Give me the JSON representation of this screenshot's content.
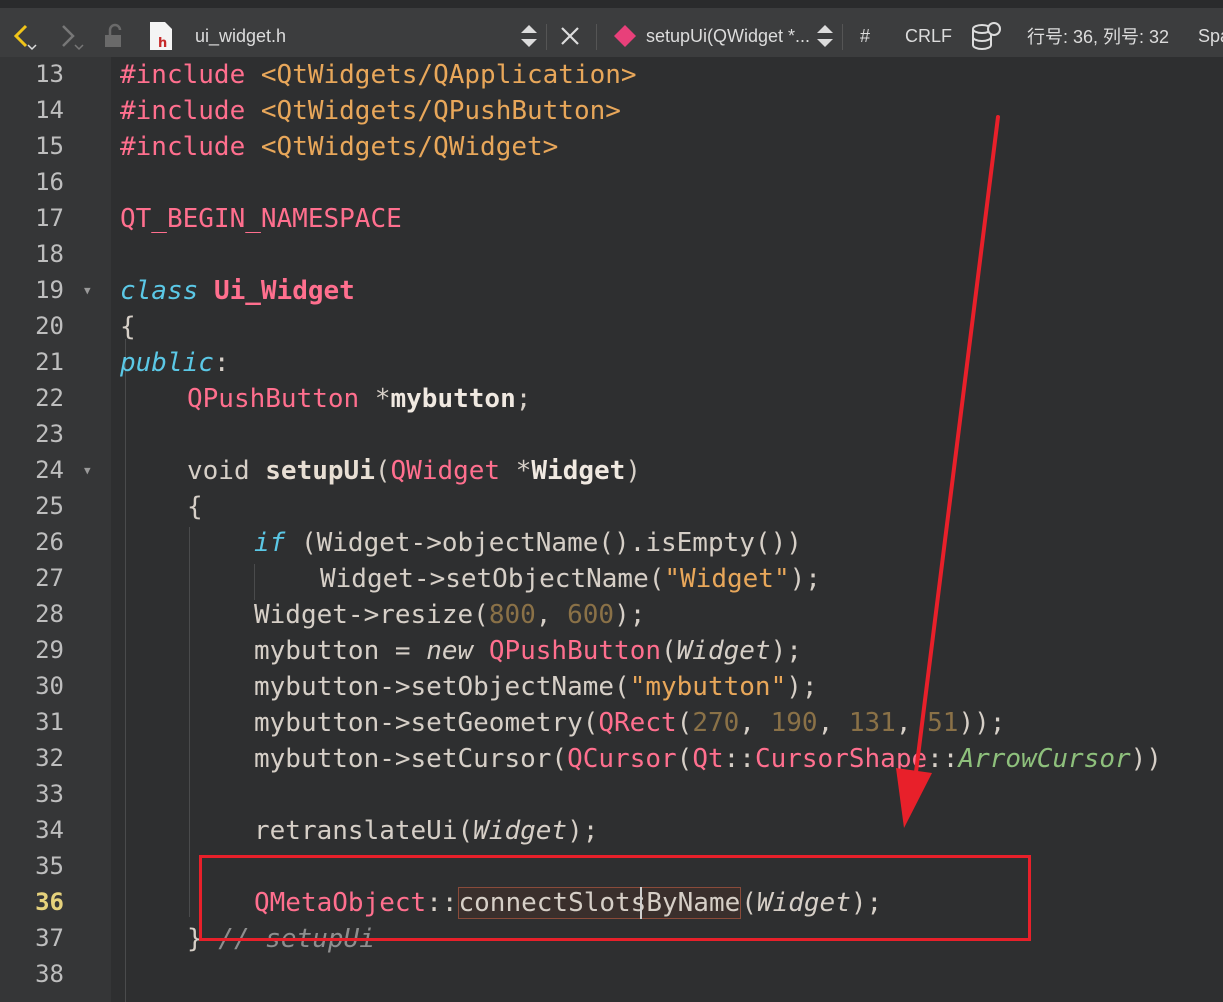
{
  "toolbar": {
    "filename": "ui_widget.h",
    "function_selector": "setupUi(QWidget *...",
    "hash_symbol": "#",
    "line_ending": "CRLF",
    "cursor_position": "行号: 36, 列号: 32",
    "indent_mode": "Spa"
  },
  "line_numbers": [
    "13",
    "14",
    "15",
    "16",
    "17",
    "18",
    "19",
    "20",
    "21",
    "22",
    "23",
    "24",
    "25",
    "26",
    "27",
    "28",
    "29",
    "30",
    "31",
    "32",
    "33",
    "34",
    "35",
    "36",
    "37",
    "38"
  ],
  "current_line": "36",
  "code": {
    "l13_a": "#include",
    "l13_b": " <QtWidgets/QApplication>",
    "l14_a": "#include",
    "l14_b": " <QtWidgets/QPushButton>",
    "l15_a": "#include",
    "l15_b": " <QtWidgets/QWidget>",
    "l17": "QT_BEGIN_NAMESPACE",
    "l19_a": "class",
    "l19_b": "Ui_Widget",
    "l20": "{",
    "l21_a": "public",
    "l21_b": ":",
    "l22_a": "QPushButton",
    "l22_b": " *",
    "l22_c": "mybutton",
    "l22_d": ";",
    "l24_a": "void ",
    "l24_b": "setupUi",
    "l24_c": "(",
    "l24_d": "QWidget",
    "l24_e": " *",
    "l24_f": "Widget",
    "l24_g": ")",
    "l25": "{",
    "l26_a": "if",
    "l26_b": " (Widget->objectName().isEmpty())",
    "l27_a": "Widget->setObjectName(",
    "l27_b": "\"Widget\"",
    "l27_c": ");",
    "l28_a": "Widget->resize(",
    "l28_b": "800",
    "l28_c": ", ",
    "l28_d": "600",
    "l28_e": ");",
    "l29_a": "mybutton = ",
    "l29_b": "new",
    "l29_c": " ",
    "l29_d": "QPushButton",
    "l29_e": "(",
    "l29_f": "Widget",
    "l29_g": ");",
    "l30_a": "mybutton->setObjectName(",
    "l30_b": "\"mybutton\"",
    "l30_c": ");",
    "l31_a": "mybutton->setGeometry(",
    "l31_b": "QRect",
    "l31_c": "(",
    "l31_d": "270",
    "l31_e": ", ",
    "l31_f": "190",
    "l31_g": ", ",
    "l31_h": "131",
    "l31_i": ", ",
    "l31_j": "51",
    "l31_k": "));",
    "l32_a": "mybutton->setCursor(",
    "l32_b": "QCursor",
    "l32_c": "(",
    "l32_d": "Qt",
    "l32_e": "::",
    "l32_f": "CursorShape",
    "l32_g": "::",
    "l32_h": "ArrowCursor",
    "l32_i": "))",
    "l34_a": "retranslateUi(",
    "l34_b": "Widget",
    "l34_c": ");",
    "l36_a": "QMetaObject",
    "l36_b": "::",
    "l36_c": "connectSlotsByName",
    "l36_d": "(",
    "l36_e": "Widget",
    "l36_f": ");",
    "l37_a": "}",
    "l37_b": " // setupUi"
  },
  "colors": {
    "annotation_red": "#e8202a",
    "keyword_pink": "#ff6f8e",
    "string_orange": "#e8a75a",
    "keyword_cyan": "#5bc8e6"
  }
}
